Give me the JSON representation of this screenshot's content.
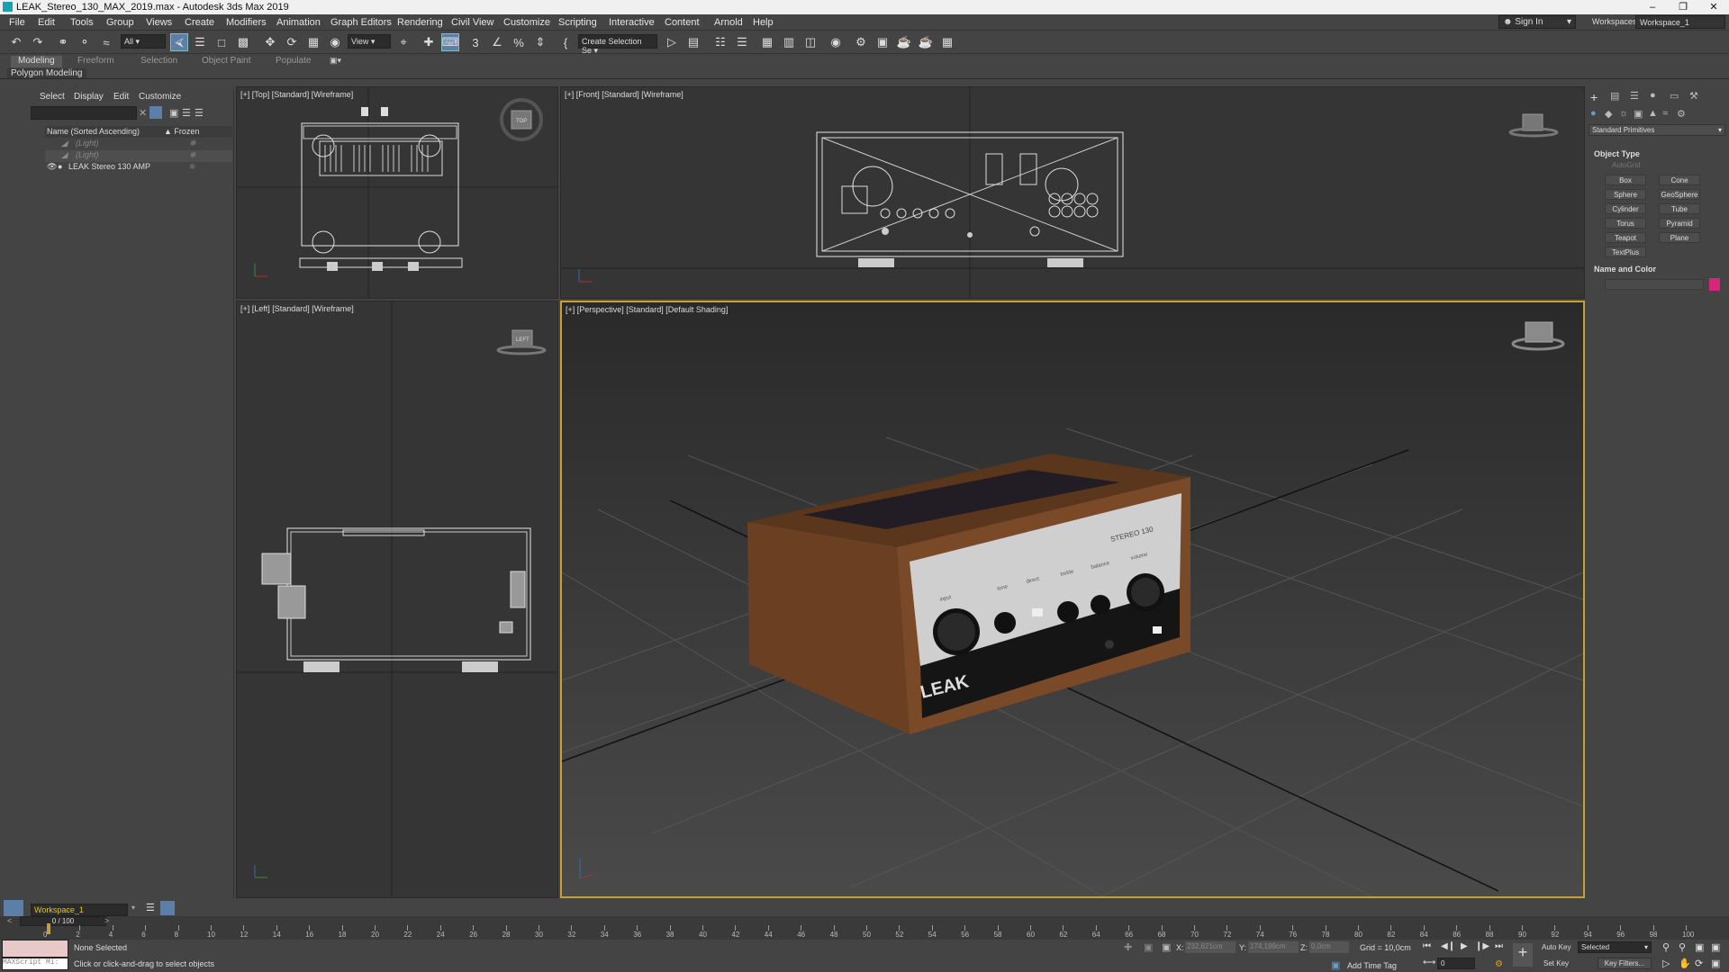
{
  "window": {
    "title": "LEAK_Stereo_130_MAX_2019.max - Autodesk 3ds Max 2019"
  },
  "menu": [
    "File",
    "Edit",
    "Tools",
    "Group",
    "Views",
    "Create",
    "Modifiers",
    "Animation",
    "Graph Editors",
    "Rendering",
    "Civil View",
    "Customize",
    "Scripting",
    "Interactive",
    "Content",
    "Arnold",
    "Help"
  ],
  "account": {
    "sign_in": "Sign In",
    "workspaces_label": "Workspaces:",
    "workspace": "Workspace_1"
  },
  "toolbar": {
    "filter": "All",
    "view": "View",
    "selection_set": "Create Selection Se"
  },
  "ribbon": {
    "tabs": [
      "Modeling",
      "Freeform",
      "Selection",
      "Object Paint",
      "Populate"
    ],
    "sub": "Polygon Modeling"
  },
  "scene_explorer": {
    "tabs": [
      "Select",
      "Display",
      "Edit",
      "Customize"
    ],
    "col_name": "Name (Sorted Ascending)",
    "col_frozen": "▲ Frozen",
    "rows": [
      "(Light)",
      "(Light)",
      "LEAK Stereo 130 AMP"
    ]
  },
  "viewports": {
    "top": "[+] [Top] [Standard] [Wireframe]",
    "front": "[+] [Front] [Standard] [Wireframe]",
    "left": "[+] [Left] [Standard] [Wireframe]",
    "persp": "[+] [Perspective] [Standard] [Default Shading]",
    "viewcube_top": "TOP",
    "viewcube_left": "LEFT"
  },
  "amp": {
    "brand": "LEAK",
    "model": "STEREO 130",
    "knob_labels": [
      "input",
      "tone",
      "direct",
      "treble",
      "balance",
      "volume"
    ],
    "wood_color": "#6a3f22",
    "panel_color": "#cfcfcf"
  },
  "command_panel": {
    "dropdown": "Standard Primitives",
    "object_type": "Object Type",
    "autogrid": "AutoGrid",
    "primitives": [
      "Box",
      "Cone",
      "Sphere",
      "GeoSphere",
      "Cylinder",
      "Tube",
      "Torus",
      "Pyramid",
      "Teapot",
      "Plane",
      "TextPlus"
    ],
    "name_color": "Name and Color",
    "color": "#d6257b"
  },
  "timeline": {
    "frame": "0 / 100",
    "ticks": [
      "0",
      "2",
      "4",
      "6",
      "8",
      "10",
      "12",
      "14",
      "16",
      "18",
      "20",
      "22",
      "24",
      "26",
      "28",
      "30",
      "32",
      "34",
      "36",
      "38",
      "40",
      "42",
      "44",
      "46",
      "48",
      "50",
      "52",
      "54",
      "56",
      "58",
      "60",
      "62",
      "64",
      "66",
      "68",
      "70",
      "72",
      "74",
      "76",
      "78",
      "80",
      "82",
      "84",
      "86",
      "88",
      "90",
      "92",
      "94",
      "96",
      "98",
      "100"
    ]
  },
  "status": {
    "workspace": "Workspace_1",
    "script": "MAXScript Mi:",
    "selected": "None Selected",
    "prompt": "Click or click-and-drag to select objects",
    "x_label": "X:",
    "x": "232,621cm",
    "y_label": "Y:",
    "y": "174,199cm",
    "z_label": "Z:",
    "z": "0,0cm",
    "grid": "Grid = 10,0cm",
    "add_time_tag": "Add Time Tag",
    "auto_key": "Auto Key",
    "set_key": "Set Key",
    "selected_dd": "Selected",
    "key_filters": "Key Filters...",
    "frame": "0"
  }
}
